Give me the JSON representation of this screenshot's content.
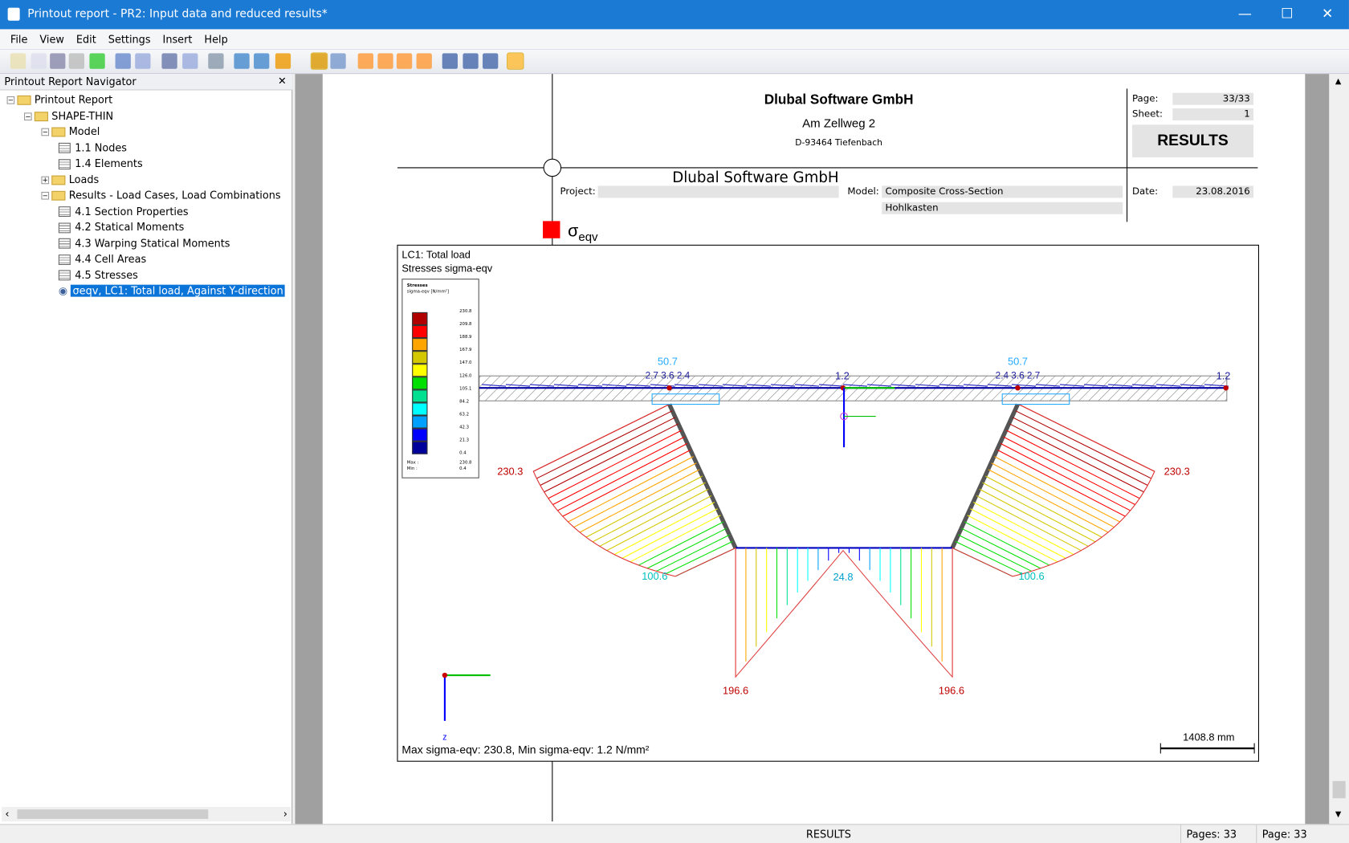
{
  "window": {
    "title": "Printout report - PR2: Input data and reduced results*",
    "controls": [
      "minimize",
      "maximize",
      "close"
    ]
  },
  "menu": [
    "File",
    "View",
    "Edit",
    "Settings",
    "Insert",
    "Help"
  ],
  "toolbar": {
    "icons": [
      "new-icon",
      "open-icon",
      "save-icon",
      "print-icon",
      "refresh-icon",
      "prev-icon",
      "next-icon",
      "first-icon",
      "last-icon",
      "export-icon",
      "zoom-in-icon",
      "zoom-out-icon",
      "settings-icon",
      "hand-icon",
      "select-icon",
      "filter-icon",
      "page-icon",
      "page2-icon",
      "page3-icon",
      "link-icon",
      "link2-icon",
      "link3-icon",
      "help-icon"
    ]
  },
  "navigator": {
    "title": "Printout Report Navigator",
    "items": [
      {
        "label": "Printout Report",
        "level": 0,
        "type": "folder"
      },
      {
        "label": "SHAPE-THIN",
        "level": 1,
        "type": "folder"
      },
      {
        "label": "Model",
        "level": 2,
        "type": "folder"
      },
      {
        "label": "1.1 Nodes",
        "level": 3,
        "type": "table"
      },
      {
        "label": "1.4 Elements",
        "level": 3,
        "type": "table"
      },
      {
        "label": "Loads",
        "level": 2,
        "type": "folder"
      },
      {
        "label": "Results - Load Cases, Load Combinations",
        "level": 2,
        "type": "folder"
      },
      {
        "label": "4.1 Section Properties",
        "level": 3,
        "type": "table"
      },
      {
        "label": "4.2 Statical Moments",
        "level": 3,
        "type": "table"
      },
      {
        "label": "4.3 Warping Statical Moments",
        "level": 3,
        "type": "table"
      },
      {
        "label": "4.4 Cell Areas",
        "level": 3,
        "type": "table"
      },
      {
        "label": "4.5 Stresses",
        "level": 3,
        "type": "table"
      },
      {
        "label": "σeqv, LC1: Total load, Against Y-direction",
        "level": 3,
        "type": "graphic",
        "selected": true
      }
    ]
  },
  "header": {
    "company": "Dlubal Software GmbH",
    "street": "Am Zellweg 2",
    "city": "D-93464 Tiefenbach",
    "page_label": "Page:",
    "page_value": "33/33",
    "sheet_label": "Sheet:",
    "sheet_value": "1",
    "section": "RESULTS",
    "project_label": "Project:",
    "project_value": "",
    "model_label": "Model:",
    "model_value": "Composite Cross-Section",
    "model_value2": "Hohlkasten",
    "date_label": "Date:",
    "date_value": "23.08.2016"
  },
  "graphic": {
    "symbol": "σ",
    "symbol_sub": "eqv",
    "accent": "#ff0000",
    "lc": "LC1: Total load",
    "subtitle": "Stresses sigma-eqv",
    "legend": {
      "title": "Stresses",
      "unit": "sigma-eqv [N/mm²]",
      "values": [
        "230.8",
        "209.8",
        "188.9",
        "167.9",
        "147.0",
        "126.0",
        "105.1",
        "84.2",
        "63.2",
        "42.3",
        "21.3",
        "0.4"
      ],
      "colors": [
        "#b00000",
        "#ff0000",
        "#ffa500",
        "#d4c800",
        "#ffff00",
        "#00e000",
        "#00e090",
        "#00ffff",
        "#00a0ff",
        "#0000ff",
        "#00009a"
      ],
      "max_label": "Max :",
      "max": "230.8",
      "min_label": "Min :",
      "min": "0.4"
    },
    "labels": {
      "web_top": "230.3",
      "web_bottom": "100.6",
      "bottom_corner": "196.6",
      "bottom_mid": "24.8",
      "flange_peak": "50.7",
      "flange_min": "1.2",
      "flange_small": "2.7 3.6 2.4",
      "flange_small_r": "2.4 3.6 2.7"
    },
    "axis_z": "z",
    "footer": "Max sigma-eqv: 230.8, Min sigma-eqv: 1.2 N/mm²",
    "scale": "1408.8 mm"
  },
  "status": {
    "section": "RESULTS",
    "pages": "Pages: 33",
    "page": "Page: 33"
  }
}
